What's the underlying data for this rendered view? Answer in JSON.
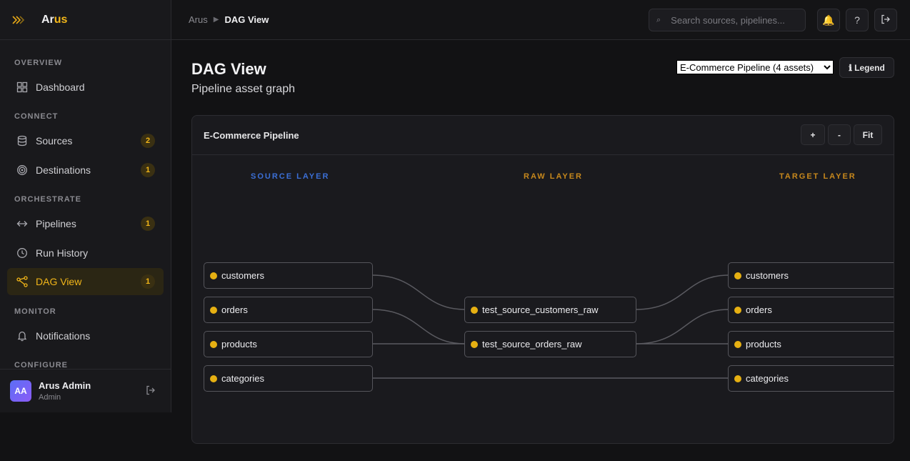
{
  "brand": {
    "name_part1": "Ar",
    "name_part2": "us",
    "logo_icon": "chevrons-right-icon"
  },
  "sidebar": {
    "sections": [
      {
        "label": "OVERVIEW"
      },
      {
        "label": "CONNECT"
      },
      {
        "label": "ORCHESTRATE"
      },
      {
        "label": "MONITOR"
      },
      {
        "label": "CONFIGURE"
      }
    ],
    "items": [
      {
        "label": "Dashboard",
        "icon": "grid-icon",
        "badge": null
      },
      {
        "label": "Sources",
        "icon": "database-icon",
        "badge": "2"
      },
      {
        "label": "Destinations",
        "icon": "target-icon",
        "badge": "1"
      },
      {
        "label": "Pipelines",
        "icon": "arrows-horizontal-icon",
        "badge": "1"
      },
      {
        "label": "Run History",
        "icon": "clock-icon",
        "badge": null
      },
      {
        "label": "DAG View",
        "icon": "dag-icon",
        "badge": "1",
        "active": true
      },
      {
        "label": "Notifications",
        "icon": "bell-icon",
        "badge": null
      }
    ],
    "user": {
      "initials": "AA",
      "name": "Arus Admin",
      "role": "Admin"
    }
  },
  "topbar": {
    "breadcrumb": [
      "Arus",
      "DAG View"
    ],
    "search_placeholder": "Search sources, pipelines..."
  },
  "page": {
    "title": "DAG View",
    "subtitle": "Pipeline asset graph",
    "pipeline_select": "E-Commerce Pipeline (4 assets)",
    "legend_label": "ℹ Legend"
  },
  "graph": {
    "title": "E-Commerce Pipeline",
    "zoom_in": "+",
    "zoom_out": "-",
    "fit": "Fit",
    "layers": [
      {
        "label": "SOURCE LAYER",
        "color": "#3b6fd6"
      },
      {
        "label": "RAW LAYER",
        "color": "#c7881c"
      },
      {
        "label": "TARGET LAYER",
        "color": "#c7881c"
      }
    ],
    "source_nodes": [
      "customers",
      "orders",
      "products",
      "categories"
    ],
    "raw_nodes": [
      "test_source_customers_raw",
      "test_source_orders_raw"
    ],
    "target_nodes": [
      "customers",
      "orders",
      "products",
      "categories"
    ],
    "status_color": "#e6b012"
  }
}
